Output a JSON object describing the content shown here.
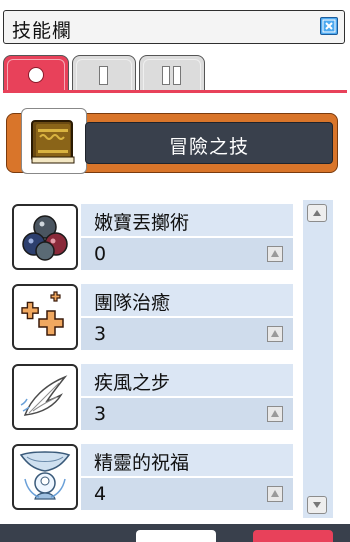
{
  "window": {
    "title": "技能欄"
  },
  "tabs": [
    {
      "label": "",
      "icon": "circle-icon",
      "active": true
    },
    {
      "label": "",
      "icon": "roman-one-icon",
      "active": false
    },
    {
      "label": "",
      "icon": "roman-two-icon",
      "active": false
    }
  ],
  "category": {
    "title": "冒險之技",
    "icon": "skill-book-icon"
  },
  "skills": [
    {
      "name": "嫩寶丟擲術",
      "level": "0",
      "icon": "snail-shells-icon"
    },
    {
      "name": "團隊治癒",
      "level": "3",
      "icon": "plus-crosses-icon"
    },
    {
      "name": "疾風之步",
      "level": "3",
      "icon": "wing-icon"
    },
    {
      "name": "精靈的祝福",
      "level": "4",
      "icon": "spirit-blessing-icon"
    }
  ],
  "colors": {
    "accent": "#e8415a",
    "category_bg": "#d9752a",
    "header_dark": "#39404c",
    "row_bg": "#dbe6f4"
  }
}
